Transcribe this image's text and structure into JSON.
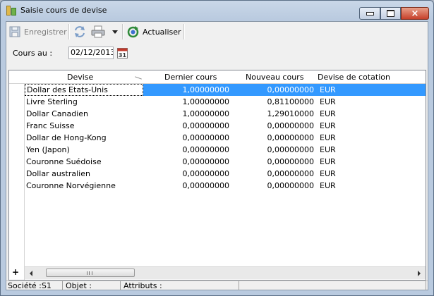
{
  "window": {
    "title": "Saisie cours de devise",
    "close_glyph": "×"
  },
  "toolbar": {
    "save_label": "Enregistrer",
    "refresh_label": "Actualiser"
  },
  "form": {
    "rate_date_label": "Cours au :",
    "rate_date_value": "02/12/2013",
    "calendar_day": "31"
  },
  "grid": {
    "columns": [
      "Devise",
      "Dernier cours",
      "Nouveau cours",
      "Devise de cotation"
    ],
    "rows": [
      {
        "devise": "Dollar des Etats-Unis",
        "dernier": "1,00000000",
        "nouveau": "0,00000000",
        "cotation": "EUR"
      },
      {
        "devise": "Livre Sterling",
        "dernier": "1,00000000",
        "nouveau": "0,81100000",
        "cotation": "EUR"
      },
      {
        "devise": "Dollar Canadien",
        "dernier": "1,00000000",
        "nouveau": "1,29010000",
        "cotation": "EUR"
      },
      {
        "devise": "Franc Suisse",
        "dernier": "0,00000000",
        "nouveau": "0,00000000",
        "cotation": "EUR"
      },
      {
        "devise": "Dollar de Hong-Kong",
        "dernier": "0,00000000",
        "nouveau": "0,00000000",
        "cotation": "EUR"
      },
      {
        "devise": "Yen (Japon)",
        "dernier": "0,00000000",
        "nouveau": "0,00000000",
        "cotation": "EUR"
      },
      {
        "devise": "Couronne Suédoise",
        "dernier": "0,00000000",
        "nouveau": "0,00000000",
        "cotation": "EUR"
      },
      {
        "devise": "Dollar australien",
        "dernier": "0,00000000",
        "nouveau": "0,00000000",
        "cotation": "EUR"
      },
      {
        "devise": "Couronne Norvégienne",
        "dernier": "0,00000000",
        "nouveau": "0,00000000",
        "cotation": "EUR"
      }
    ],
    "add_row_label": "+"
  },
  "status": {
    "societe": "Société :S1",
    "objet": "Objet :",
    "attributs": "Attributs :"
  },
  "colors": {
    "selection": "#3399ff",
    "titlebar": "#b9cadf",
    "close_button": "#c7402a"
  },
  "icons": [
    "app-icon",
    "save-icon",
    "sync-icon",
    "print-icon",
    "dropdown-arrow-icon",
    "refresh-icon",
    "calendar-icon"
  ]
}
